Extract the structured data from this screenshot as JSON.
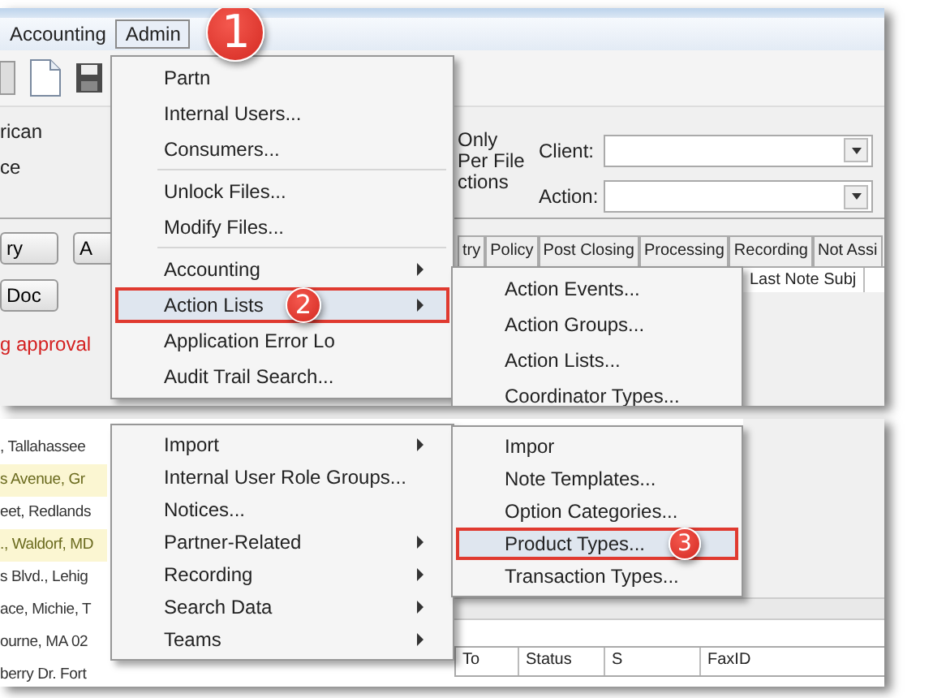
{
  "top_panel": {
    "menu_bar": [
      {
        "label": "Accounting",
        "selected": false
      },
      {
        "label": "Admin",
        "selected": true,
        "callout": "1"
      }
    ],
    "left_texts": [
      "rican",
      "ce"
    ],
    "filter_texts": [
      "Only",
      "Per File",
      "ctions"
    ],
    "fields": [
      {
        "label": "Client:"
      },
      {
        "label": "Action:"
      }
    ],
    "buttons": [
      "ry",
      "A",
      "Doc"
    ],
    "warning": "g approval",
    "tabs": [
      "try",
      "Policy",
      "Post Closing",
      "Processing",
      "Recording",
      "Not Assi"
    ],
    "column_headers": [
      "Last Note Subj"
    ],
    "admin_menu": [
      {
        "kind": "item",
        "label": "Partn",
        "outlined": false
      },
      {
        "kind": "item",
        "label": "Internal Users...",
        "outlined": false
      },
      {
        "kind": "item",
        "label": "Consumers...",
        "outlined": false
      },
      {
        "kind": "separator"
      },
      {
        "kind": "item",
        "label": "Unlock Files...",
        "outlined": false
      },
      {
        "kind": "item",
        "label": "Modify Files...",
        "outlined": false
      },
      {
        "kind": "separator"
      },
      {
        "kind": "submenu",
        "label": "Accounting",
        "outlined": false
      },
      {
        "kind": "submenu",
        "label": "Action Lists",
        "outlined": true,
        "callout": "2"
      },
      {
        "kind": "item",
        "label": "Application Error Lo",
        "outlined": false
      },
      {
        "kind": "item",
        "label": "Audit Trail Search...",
        "outlined": false
      }
    ],
    "submenu": [
      {
        "kind": "item",
        "label": "Action Events...",
        "outlined": false
      },
      {
        "kind": "item",
        "label": "Action Groups...",
        "outlined": false
      },
      {
        "kind": "item",
        "label": "Action Lists...",
        "outlined": false
      },
      {
        "kind": "item",
        "label": "Coordinator Types...",
        "outlined": false
      }
    ]
  },
  "bottom_panel": {
    "addresses": [
      {
        "text": ", Tallahassee",
        "highlighted": false
      },
      {
        "text": "s Avenue, Gr",
        "highlighted": true
      },
      {
        "text": "eet, Redlands",
        "highlighted": false
      },
      {
        "text": "., Waldorf, MD",
        "highlighted": true
      },
      {
        "text": "s Blvd., Lehig",
        "highlighted": false
      },
      {
        "text": "ace, Michie, T",
        "highlighted": false
      },
      {
        "text": "ourne, MA 02",
        "highlighted": false
      },
      {
        "text": "berry Dr. Fort",
        "highlighted": false
      }
    ],
    "admin_menu": [
      {
        "kind": "submenu",
        "label": "Import",
        "outlined": false
      },
      {
        "kind": "item",
        "label": "Internal User Role Groups...",
        "outlined": false
      },
      {
        "kind": "item",
        "label": "Notices...",
        "outlined": false
      },
      {
        "kind": "submenu",
        "label": "Partner-Related",
        "outlined": false
      },
      {
        "kind": "submenu",
        "label": "Recording",
        "outlined": false
      },
      {
        "kind": "submenu",
        "label": "Search Data",
        "outlined": false
      },
      {
        "kind": "submenu",
        "label": "Teams",
        "outlined": false
      }
    ],
    "submenu": [
      {
        "kind": "item",
        "label": "Impor",
        "outlined": false
      },
      {
        "kind": "item",
        "label": "Note Templates...",
        "outlined": false
      },
      {
        "kind": "item",
        "label": "Option Categories...",
        "outlined": false
      },
      {
        "kind": "item",
        "label": "Product Types...",
        "outlined": true,
        "callout": "3"
      },
      {
        "kind": "item",
        "label": "Transaction Types...",
        "outlined": false
      }
    ],
    "column_headers": [
      "To",
      "Status",
      "S",
      "FaxID"
    ]
  }
}
